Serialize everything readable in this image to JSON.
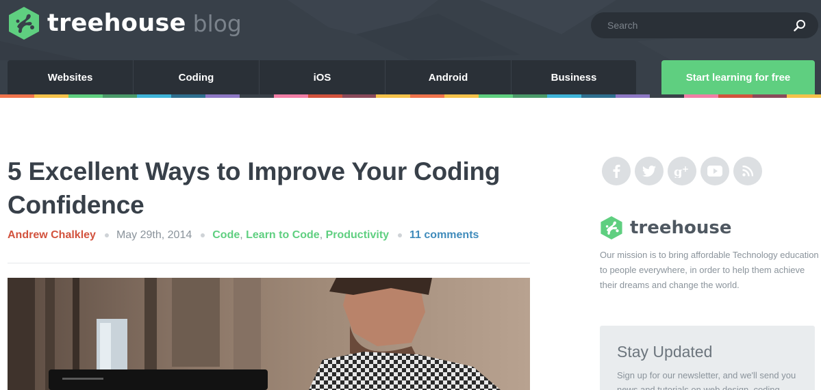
{
  "brand": {
    "name": "treehouse",
    "section": "blog",
    "green": "#5fcf80"
  },
  "search": {
    "placeholder": "Search",
    "icon": "search-icon"
  },
  "nav": {
    "items": [
      {
        "label": "Websites"
      },
      {
        "label": "Coding"
      },
      {
        "label": "iOS"
      },
      {
        "label": "Android"
      },
      {
        "label": "Business"
      }
    ],
    "cta_label": "Start learning for free"
  },
  "stripe_colors": [
    "#f0744c",
    "#f5c24a",
    "#5fcf80",
    "#4a9a6a",
    "#3fb4d8",
    "#2f6f8f",
    "#8e78c4",
    "#3a4149",
    "#f27ea6",
    "#d2523d",
    "#8a4a5a",
    "#f5c24a"
  ],
  "article": {
    "title": "5 Excellent Ways to Improve Your Coding Confidence",
    "author": "Andrew Chalkley",
    "date": "May 29th, 2014",
    "categories": [
      "Code",
      "Learn to Code",
      "Productivity"
    ],
    "comments": "11 comments"
  },
  "sidebar": {
    "social": [
      "facebook-icon",
      "twitter-icon",
      "google-plus-icon",
      "youtube-icon",
      "rss-icon"
    ],
    "logo_text": "treehouse",
    "mission": "Our mission is to bring affordable Technology education to people everywhere, in order to help them achieve their dreams and change the world.",
    "newsletter": {
      "title": "Stay Updated",
      "text": "Sign up for our newsletter, and we'll send you news and tutorials on web design, coding,"
    }
  }
}
